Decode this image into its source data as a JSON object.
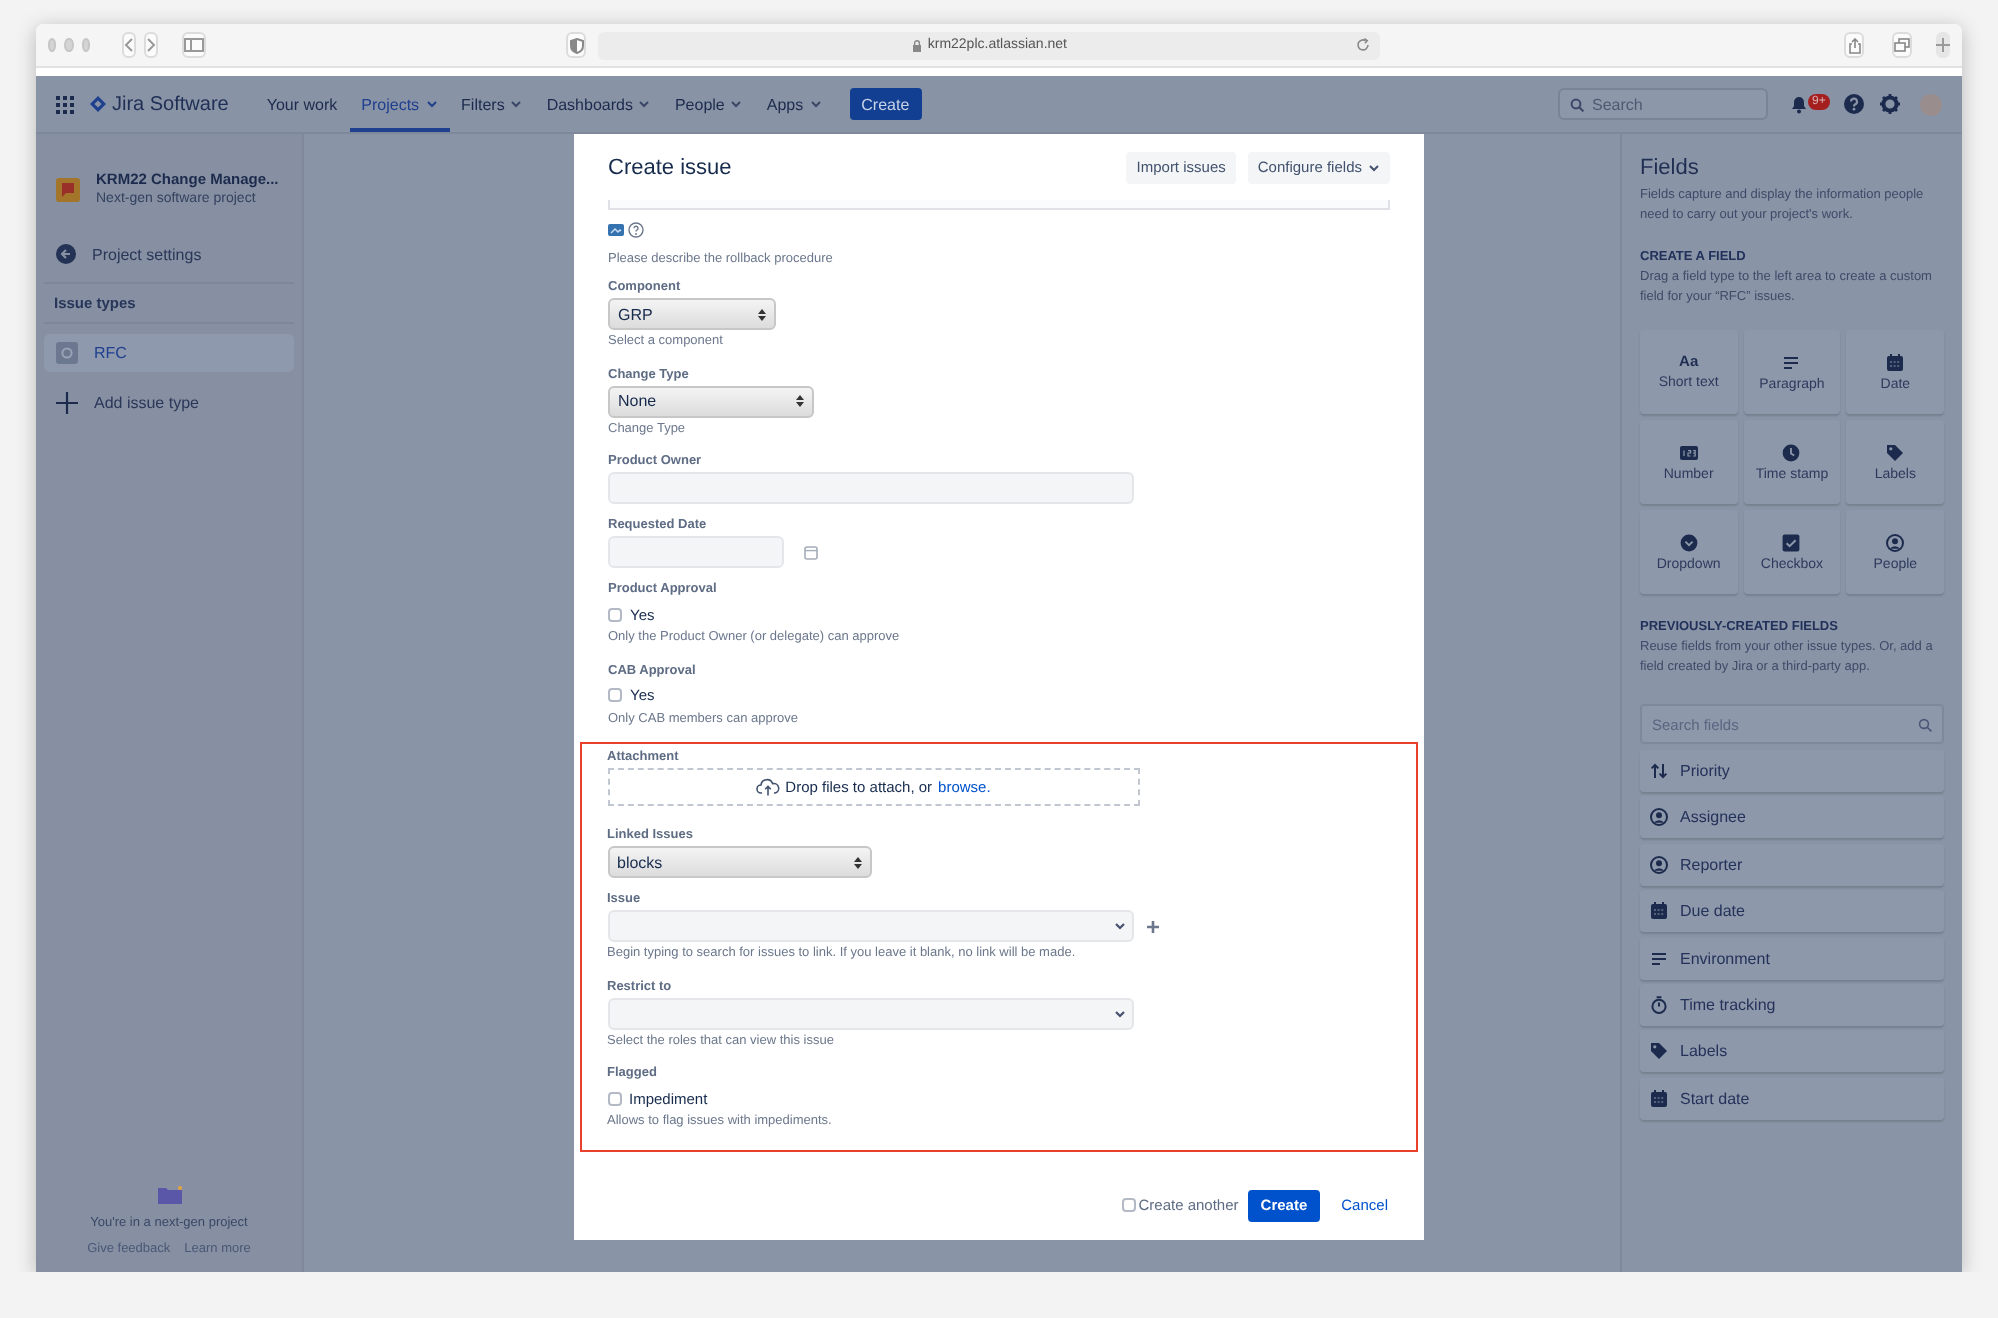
{
  "browser": {
    "url": "krm22plc.atlassian.net"
  },
  "nav": {
    "product": "Jira Software",
    "items": [
      {
        "label": "Your work",
        "dropdown": false,
        "selected": false
      },
      {
        "label": "Projects",
        "dropdown": true,
        "selected": true
      },
      {
        "label": "Filters",
        "dropdown": true,
        "selected": false
      },
      {
        "label": "Dashboards",
        "dropdown": true,
        "selected": false
      },
      {
        "label": "People",
        "dropdown": true,
        "selected": false
      },
      {
        "label": "Apps",
        "dropdown": true,
        "selected": false
      }
    ],
    "create": "Create",
    "search": {
      "placeholder": "Search"
    },
    "notifications_badge": "9+"
  },
  "sidebar": {
    "project": {
      "name": "KRM22 Change Manage...",
      "subtitle": "Next-gen software project"
    },
    "settings": "Project settings",
    "section": "Issue types",
    "items": [
      {
        "label": "RFC",
        "kind": "type",
        "selected": true
      },
      {
        "label": "Add issue type",
        "kind": "add",
        "selected": false
      }
    ],
    "footer": {
      "text": "You're in a next-gen project",
      "links": [
        "Give feedback",
        "Learn more"
      ]
    }
  },
  "modal": {
    "title": "Create issue",
    "actions": [
      {
        "label": "Import issues",
        "dropdown": false
      },
      {
        "label": "Configure fields",
        "dropdown": true
      }
    ],
    "sections": [
      {
        "highlighted": false,
        "fields": [
          {
            "kind": "editor",
            "help": "Please describe the rollback procedure"
          },
          {
            "kind": "select",
            "label": "Component",
            "value": "GRP",
            "help": "Select a component"
          },
          {
            "kind": "select",
            "label": "Change Type",
            "value": "None",
            "help": "Change Type"
          },
          {
            "kind": "text",
            "label": "Product Owner"
          },
          {
            "kind": "date",
            "label": "Requested Date"
          },
          {
            "kind": "checkbox",
            "label": "Product Approval",
            "option": "Yes",
            "checked": false,
            "help": "Only the Product Owner (or delegate) can approve"
          },
          {
            "kind": "checkbox",
            "label": "CAB Approval",
            "option": "Yes",
            "checked": false,
            "help": "Only CAB members can approve"
          }
        ]
      },
      {
        "highlighted": true,
        "fields": [
          {
            "kind": "attachment",
            "label": "Attachment",
            "text": "Drop files to attach, or",
            "link": "browse."
          },
          {
            "kind": "select",
            "label": "Linked Issues",
            "value": "blocks"
          },
          {
            "kind": "combo",
            "label": "Issue",
            "addable": true,
            "help": "Begin typing to search for issues to link. If you leave it blank, no link will be made."
          },
          {
            "kind": "combo",
            "label": "Restrict to",
            "help": "Select the roles that can view this issue"
          },
          {
            "kind": "checkbox",
            "label": "Flagged",
            "option": "Impediment",
            "checked": false,
            "help": "Allows to flag issues with impediments."
          }
        ]
      }
    ],
    "footer": {
      "create_another": {
        "label": "Create another",
        "checked": false
      },
      "submit": "Create",
      "cancel": "Cancel"
    }
  },
  "fields_panel": {
    "title": "Fields",
    "description": "Fields capture and display the information people need to carry out your project's work.",
    "create_heading": "CREATE A FIELD",
    "create_description": "Drag a field type to the left area to create a custom field for your “RFC” issues.",
    "tiles": [
      {
        "label": "Short text",
        "glyph": "Aa"
      },
      {
        "label": "Paragraph"
      },
      {
        "label": "Date"
      },
      {
        "label": "Number"
      },
      {
        "label": "Time stamp"
      },
      {
        "label": "Labels"
      },
      {
        "label": "Dropdown"
      },
      {
        "label": "Checkbox"
      },
      {
        "label": "People"
      }
    ],
    "previous_heading": "PREVIOUSLY-CREATED FIELDS",
    "previous_description": "Reuse fields from your other issue types. Or, add a field created by Jira or a third-party app.",
    "search": {
      "placeholder": "Search fields"
    },
    "items": [
      "Priority",
      "Assignee",
      "Reporter",
      "Due date",
      "Environment",
      "Time tracking",
      "Labels",
      "Start date"
    ]
  }
}
